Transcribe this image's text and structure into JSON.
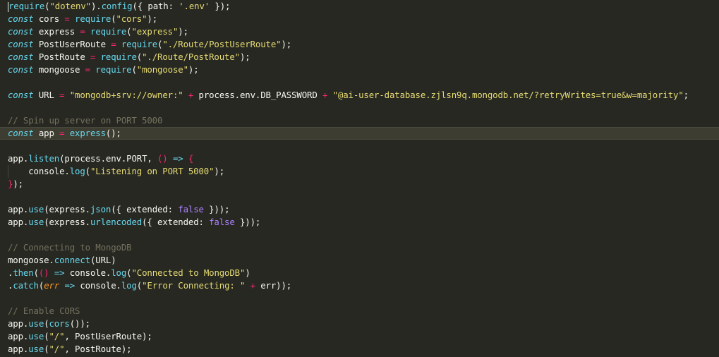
{
  "editor": {
    "theme": "monokai",
    "colors": {
      "background": "#272822",
      "active_line": "#3e3d32",
      "text": "#f8f8f2",
      "keyword": "#66d9ef",
      "function": "#66d9ef",
      "string": "#e6db74",
      "operator": "#f92672",
      "constant": "#ae81ff",
      "parameter": "#fd971f",
      "comment": "#75715e"
    },
    "active_line_index": 10,
    "lines": [
      {
        "tokens": [
          {
            "t": "require",
            "c": "func"
          },
          {
            "t": "(",
            "c": "plain"
          },
          {
            "t": "\"dotenv\"",
            "c": "str"
          },
          {
            "t": ").",
            "c": "plain"
          },
          {
            "t": "config",
            "c": "func"
          },
          {
            "t": "({ path: ",
            "c": "plain"
          },
          {
            "t": "'.env'",
            "c": "str"
          },
          {
            "t": " });",
            "c": "plain"
          }
        ]
      },
      {
        "tokens": [
          {
            "t": "const",
            "c": "kw"
          },
          {
            "t": " cors ",
            "c": "plain"
          },
          {
            "t": "=",
            "c": "op"
          },
          {
            "t": " ",
            "c": "plain"
          },
          {
            "t": "require",
            "c": "func"
          },
          {
            "t": "(",
            "c": "plain"
          },
          {
            "t": "\"cors\"",
            "c": "str"
          },
          {
            "t": ");",
            "c": "plain"
          }
        ]
      },
      {
        "tokens": [
          {
            "t": "const",
            "c": "kw"
          },
          {
            "t": " express ",
            "c": "plain"
          },
          {
            "t": "=",
            "c": "op"
          },
          {
            "t": " ",
            "c": "plain"
          },
          {
            "t": "require",
            "c": "func"
          },
          {
            "t": "(",
            "c": "plain"
          },
          {
            "t": "\"express\"",
            "c": "str"
          },
          {
            "t": ");",
            "c": "plain"
          }
        ]
      },
      {
        "tokens": [
          {
            "t": "const",
            "c": "kw"
          },
          {
            "t": " PostUserRoute ",
            "c": "plain"
          },
          {
            "t": "=",
            "c": "op"
          },
          {
            "t": " ",
            "c": "plain"
          },
          {
            "t": "require",
            "c": "func"
          },
          {
            "t": "(",
            "c": "plain"
          },
          {
            "t": "\"./Route/PostUserRoute\"",
            "c": "str"
          },
          {
            "t": ");",
            "c": "plain"
          }
        ]
      },
      {
        "tokens": [
          {
            "t": "const",
            "c": "kw"
          },
          {
            "t": " PostRoute ",
            "c": "plain"
          },
          {
            "t": "=",
            "c": "op"
          },
          {
            "t": " ",
            "c": "plain"
          },
          {
            "t": "require",
            "c": "func"
          },
          {
            "t": "(",
            "c": "plain"
          },
          {
            "t": "\"./Route/PostRoute\"",
            "c": "str"
          },
          {
            "t": ");",
            "c": "plain"
          }
        ]
      },
      {
        "tokens": [
          {
            "t": "const",
            "c": "kw"
          },
          {
            "t": " mongoose ",
            "c": "plain"
          },
          {
            "t": "=",
            "c": "op"
          },
          {
            "t": " ",
            "c": "plain"
          },
          {
            "t": "require",
            "c": "func"
          },
          {
            "t": "(",
            "c": "plain"
          },
          {
            "t": "\"mongoose\"",
            "c": "str"
          },
          {
            "t": ");",
            "c": "plain"
          }
        ]
      },
      {
        "tokens": []
      },
      {
        "tokens": [
          {
            "t": "const",
            "c": "kw"
          },
          {
            "t": " URL ",
            "c": "plain"
          },
          {
            "t": "=",
            "c": "op"
          },
          {
            "t": " ",
            "c": "plain"
          },
          {
            "t": "\"mongodb+srv://owner:\"",
            "c": "str"
          },
          {
            "t": " ",
            "c": "plain"
          },
          {
            "t": "+",
            "c": "op"
          },
          {
            "t": " process.env.DB_PASSWORD ",
            "c": "plain"
          },
          {
            "t": "+",
            "c": "op"
          },
          {
            "t": " ",
            "c": "plain"
          },
          {
            "t": "\"@ai-user-database.zjlsn9q.mongodb.net/?retryWrites=true&w=majority\"",
            "c": "str"
          },
          {
            "t": ";",
            "c": "plain"
          }
        ]
      },
      {
        "tokens": []
      },
      {
        "tokens": [
          {
            "t": "// Spin up server on PORT 5000",
            "c": "comment"
          }
        ]
      },
      {
        "tokens": [
          {
            "t": "const",
            "c": "kw"
          },
          {
            "t": " app ",
            "c": "plain"
          },
          {
            "t": "=",
            "c": "op"
          },
          {
            "t": " ",
            "c": "plain"
          },
          {
            "t": "express",
            "c": "func"
          },
          {
            "t": "();",
            "c": "plain"
          }
        ]
      },
      {
        "tokens": []
      },
      {
        "tokens": [
          {
            "t": "app.",
            "c": "plain"
          },
          {
            "t": "listen",
            "c": "func"
          },
          {
            "t": "(process.env.PORT, ",
            "c": "plain"
          },
          {
            "t": "()",
            "c": "op"
          },
          {
            "t": " ",
            "c": "plain"
          },
          {
            "t": "=>",
            "c": "kw"
          },
          {
            "t": " ",
            "c": "plain"
          },
          {
            "t": "{",
            "c": "op"
          }
        ]
      },
      {
        "indent": true,
        "tokens": [
          {
            "t": "    console.",
            "c": "plain"
          },
          {
            "t": "log",
            "c": "func"
          },
          {
            "t": "(",
            "c": "plain"
          },
          {
            "t": "\"Listening on PORT 5000\"",
            "c": "str"
          },
          {
            "t": ");",
            "c": "plain"
          }
        ]
      },
      {
        "tokens": [
          {
            "t": "}",
            "c": "op"
          },
          {
            "t": ");",
            "c": "plain"
          }
        ]
      },
      {
        "tokens": []
      },
      {
        "tokens": [
          {
            "t": "app.",
            "c": "plain"
          },
          {
            "t": "use",
            "c": "func"
          },
          {
            "t": "(express.",
            "c": "plain"
          },
          {
            "t": "json",
            "c": "func"
          },
          {
            "t": "({ extended: ",
            "c": "plain"
          },
          {
            "t": "false",
            "c": "const"
          },
          {
            "t": " }));",
            "c": "plain"
          }
        ]
      },
      {
        "tokens": [
          {
            "t": "app.",
            "c": "plain"
          },
          {
            "t": "use",
            "c": "func"
          },
          {
            "t": "(express.",
            "c": "plain"
          },
          {
            "t": "urlencoded",
            "c": "func"
          },
          {
            "t": "({ extended: ",
            "c": "plain"
          },
          {
            "t": "false",
            "c": "const"
          },
          {
            "t": " }));",
            "c": "plain"
          }
        ]
      },
      {
        "tokens": []
      },
      {
        "tokens": [
          {
            "t": "// Connecting to MongoDB",
            "c": "comment"
          }
        ]
      },
      {
        "tokens": [
          {
            "t": "mongoose.",
            "c": "plain"
          },
          {
            "t": "connect",
            "c": "func"
          },
          {
            "t": "(URL)",
            "c": "plain"
          }
        ]
      },
      {
        "tokens": [
          {
            "t": ".",
            "c": "plain"
          },
          {
            "t": "then",
            "c": "func"
          },
          {
            "t": "(",
            "c": "plain"
          },
          {
            "t": "()",
            "c": "op"
          },
          {
            "t": " ",
            "c": "plain"
          },
          {
            "t": "=>",
            "c": "kw"
          },
          {
            "t": " console.",
            "c": "plain"
          },
          {
            "t": "log",
            "c": "func"
          },
          {
            "t": "(",
            "c": "plain"
          },
          {
            "t": "\"Connected to MongoDB\"",
            "c": "str"
          },
          {
            "t": ")",
            "c": "plain"
          }
        ]
      },
      {
        "tokens": [
          {
            "t": ".",
            "c": "plain"
          },
          {
            "t": "catch",
            "c": "func"
          },
          {
            "t": "(",
            "c": "plain"
          },
          {
            "t": "err",
            "c": "param"
          },
          {
            "t": " ",
            "c": "plain"
          },
          {
            "t": "=>",
            "c": "kw"
          },
          {
            "t": " console.",
            "c": "plain"
          },
          {
            "t": "log",
            "c": "func"
          },
          {
            "t": "(",
            "c": "plain"
          },
          {
            "t": "\"Error Connecting: \"",
            "c": "str"
          },
          {
            "t": " ",
            "c": "plain"
          },
          {
            "t": "+",
            "c": "op"
          },
          {
            "t": " err));",
            "c": "plain"
          }
        ]
      },
      {
        "tokens": []
      },
      {
        "tokens": [
          {
            "t": "// Enable CORS",
            "c": "comment"
          }
        ]
      },
      {
        "tokens": [
          {
            "t": "app.",
            "c": "plain"
          },
          {
            "t": "use",
            "c": "func"
          },
          {
            "t": "(",
            "c": "plain"
          },
          {
            "t": "cors",
            "c": "func"
          },
          {
            "t": "());",
            "c": "plain"
          }
        ]
      },
      {
        "tokens": [
          {
            "t": "app.",
            "c": "plain"
          },
          {
            "t": "use",
            "c": "func"
          },
          {
            "t": "(",
            "c": "plain"
          },
          {
            "t": "\"/\"",
            "c": "str"
          },
          {
            "t": ", PostUserRoute);",
            "c": "plain"
          }
        ]
      },
      {
        "tokens": [
          {
            "t": "app.",
            "c": "plain"
          },
          {
            "t": "use",
            "c": "func"
          },
          {
            "t": "(",
            "c": "plain"
          },
          {
            "t": "\"/\"",
            "c": "str"
          },
          {
            "t": ", PostRoute);",
            "c": "plain"
          }
        ]
      }
    ]
  }
}
